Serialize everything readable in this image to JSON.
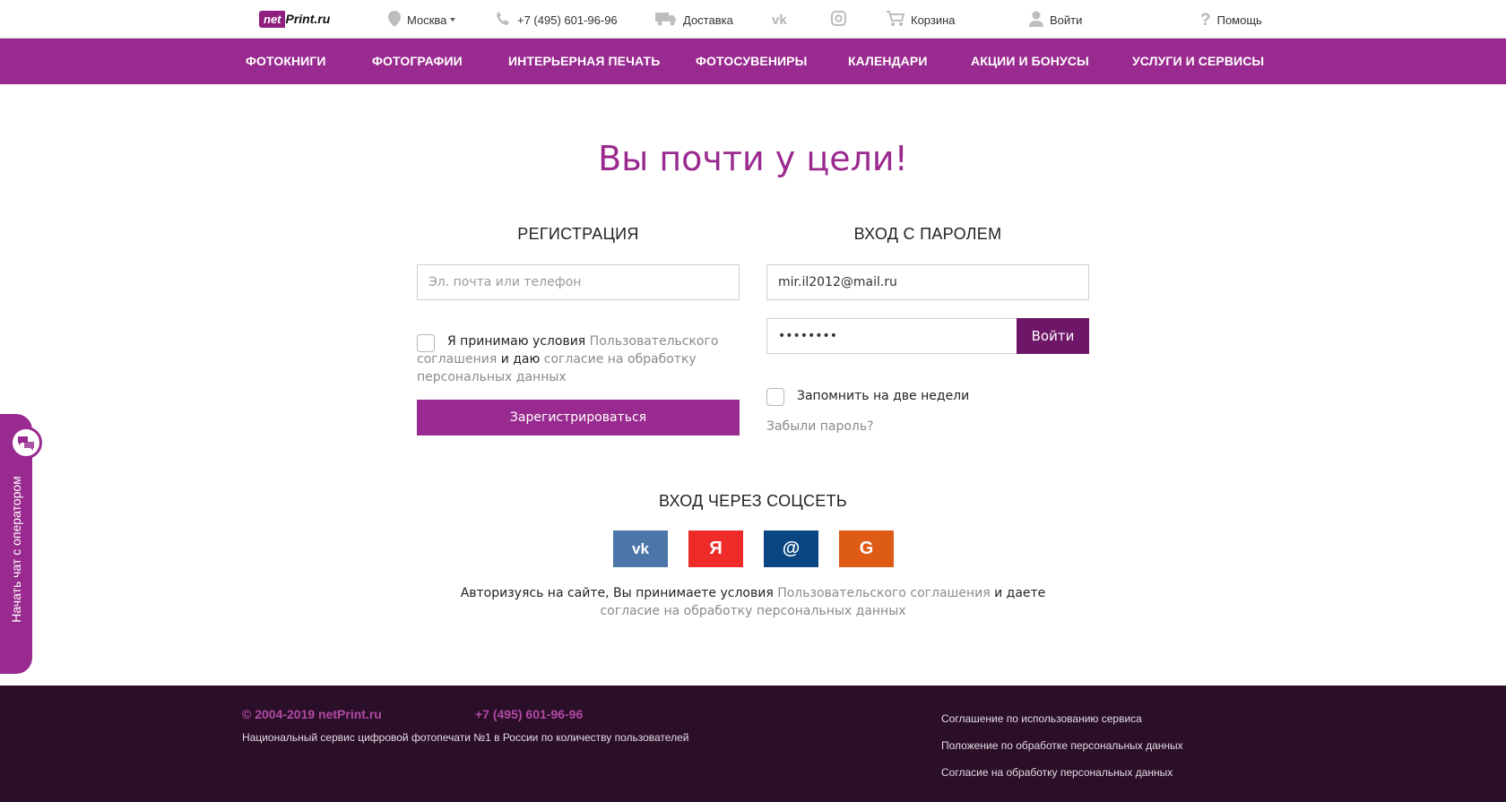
{
  "header": {
    "logo_net": "net",
    "logo_print": "Print.ru",
    "city": "Москва",
    "phone": "+7 (495) 601-96-96",
    "delivery": "Доставка",
    "cart": "Корзина",
    "login": "Войти",
    "help": "Помощь"
  },
  "nav": {
    "items": [
      "ФОТОКНИГИ",
      "ФОТОГРАФИИ",
      "ИНТЕРЬЕРНАЯ ПЕЧАТЬ",
      "ФОТОСУВЕНИРЫ",
      "КАЛЕНДАРИ",
      "АКЦИИ И БОНУСЫ",
      "УСЛУГИ И СЕРВИСЫ"
    ]
  },
  "main": {
    "title": "Вы почти у цели!",
    "register": {
      "heading": "РЕГИСТРАЦИЯ",
      "placeholder": "Эл. почта или телефон",
      "terms_1": "Я принимаю условия ",
      "terms_link_1": "Пользовательского соглашения",
      "terms_2": " и даю ",
      "terms_link_2": "согласие на обработку персональных данных",
      "button": "Зарегистрироваться"
    },
    "login": {
      "heading": "ВХОД С ПАРОЛЕМ",
      "email": "mir.il2012@mail.ru",
      "password": "••••••••",
      "button": "Войти",
      "remember": "Запомнить на две недели",
      "forgot": "Забыли пароль?"
    },
    "social": {
      "heading": "ВХОД ЧЕРЕЗ СОЦСЕТЬ",
      "buttons": [
        {
          "label": "vk",
          "color": "#4a76a8"
        },
        {
          "label": "Я",
          "color": "#ef2b2a"
        },
        {
          "label": "@",
          "color": "#0a4682"
        },
        {
          "label": "G",
          "color": "#de5b16"
        }
      ],
      "note_1": "Авторизуясь на сайте, Вы принимаете условия ",
      "note_link_1": "Пользовательского соглашения",
      "note_2": " и даете ",
      "note_link_2": "согласие на обработку персональных данных"
    }
  },
  "chat": {
    "label": "Начать чат с оператором"
  },
  "footer": {
    "copyright": "© 2004-2019 netPrint.ru",
    "phone": "+7 (495) 601-96-96",
    "description": "Национальный сервис цифровой фотопечати №1 в России по количеству пользователей",
    "links": [
      "Соглашение по использованию сервиса",
      "Положение по обработке персональных данных",
      "Согласие на обработку персональных данных"
    ]
  }
}
